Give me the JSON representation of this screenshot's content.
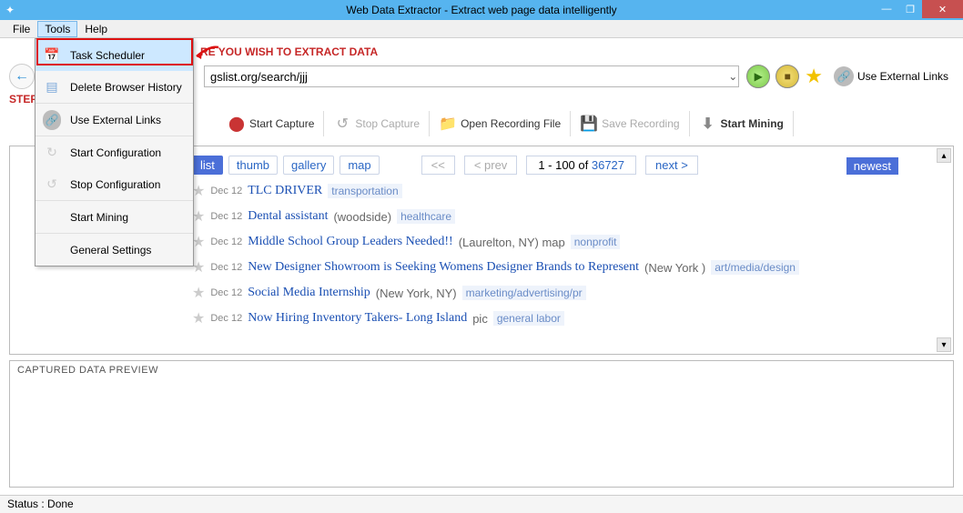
{
  "titlebar": {
    "title": "Web Data Extractor -  Extract web page data intelligently"
  },
  "menu": {
    "file": "File",
    "tools": "Tools",
    "help": "Help"
  },
  "tools_menu": {
    "task_scheduler": "Task Scheduler",
    "delete_history": "Delete Browser History",
    "use_external_links": "Use External Links",
    "start_config": "Start Configuration",
    "stop_config": "Stop Configuration",
    "start_mining": "Start Mining",
    "general_settings": "General Settings"
  },
  "steps": {
    "step1_full": "RE YOU WISH TO EXTRACT DATA",
    "step2_prefix": "STEP"
  },
  "url": {
    "value": "gslist.org/search/jjj"
  },
  "ext_links_label": "Use External Links",
  "toolbar": {
    "start_capture": "Start Capture",
    "stop_capture": "Stop Capture",
    "open_recording": "Open Recording File",
    "save_recording": "Save Recording",
    "start_mining": "Start Mining"
  },
  "filters": {
    "list": "list",
    "thumb": "thumb",
    "gallery": "gallery",
    "map": "map"
  },
  "pager": {
    "prev2": "<<",
    "prev": "< prev",
    "range_a": "1 - 100 of ",
    "range_b": "36727",
    "next": "next >",
    "newest": "newest"
  },
  "listings": [
    {
      "date": "Dec 12",
      "title": "TLC DRIVER",
      "place": "",
      "tag": "transportation"
    },
    {
      "date": "Dec 12",
      "title": "Dental assistant",
      "place": "(woodside)",
      "tag": "healthcare"
    },
    {
      "date": "Dec 12",
      "title": "Middle School Group Leaders Needed!!",
      "place": "(Laurelton, NY) map",
      "tag": "nonprofit"
    },
    {
      "date": "Dec 12",
      "title": "New Designer Showroom is Seeking Womens Designer Brands to Represent",
      "place": "(New York )",
      "tag": "art/media/design"
    },
    {
      "date": "Dec 12",
      "title": "Social Media Internship",
      "place": "(New York, NY)",
      "tag": "marketing/advertising/pr"
    },
    {
      "date": "Dec 12",
      "title": "Now Hiring Inventory Takers- Long Island",
      "place": "pic",
      "tag": "general labor"
    }
  ],
  "capture": {
    "head": "CAPTURED DATA PREVIEW"
  },
  "status": {
    "text": "Status :  Done"
  }
}
